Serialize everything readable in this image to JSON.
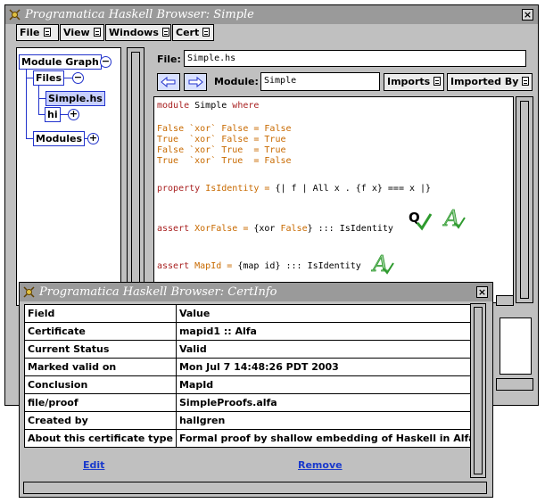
{
  "main_window": {
    "title": "Programatica Haskell Browser: Simple",
    "close_label": "×",
    "menu": [
      {
        "label": "File"
      },
      {
        "label": "View"
      },
      {
        "label": "Windows"
      },
      {
        "label": "Cert"
      }
    ],
    "tree": {
      "module_graph": "Module Graph",
      "files": "Files",
      "simple_hs": "Simple.hs",
      "hi": "hi",
      "modules": "Modules"
    },
    "file_label": "File:",
    "file_value": "Simple.hs",
    "module_label": "Module:",
    "module_value": "Simple",
    "imports_label": "Imports",
    "imported_by_label": "Imported By",
    "code": {
      "line1_kw": "module",
      "line1_rest": " Simple ",
      "line1_kw2": "where",
      "xor1": "False `xor` False = False",
      "xor2": "True  `xor` False = True",
      "xor3": "False `xor` True  = True",
      "xor4": "True  `xor` True  = False",
      "prop_kw": "property",
      "prop_name": " IsIdentity = ",
      "prop_body": "{| f | All x . {f x} === x |}",
      "assert1_kw": "assert",
      "assert1_name": " XorFalse = ",
      "assert1_body_a": "{xor ",
      "assert1_body_b": "False",
      "assert1_body_c": "} ::: IsIdentity",
      "assert2_kw": "assert",
      "assert2_name": " MapId = ",
      "assert2_body": "{map id} ::: IsIdentity"
    },
    "cert_icons": [
      "q-check-icon",
      "alfa-icon",
      "alfa-icon"
    ],
    "icon_letters": {
      "q": "Q",
      "alfa": "A"
    }
  },
  "cert_window": {
    "title": "Programatica Haskell Browser: CertInfo",
    "close_label": "×",
    "table": {
      "header": [
        "Field",
        "Value"
      ],
      "rows": [
        [
          "Certificate",
          "mapid1 :: Alfa"
        ],
        [
          "Current Status",
          "Valid"
        ],
        [
          "Marked valid on",
          "Mon Jul  7 14:48:26 PDT 2003"
        ],
        [
          "Conclusion",
          "MapId"
        ],
        [
          "file/proof",
          "SimpleProofs.alfa"
        ],
        [
          "Created by",
          "hallgren"
        ],
        [
          "About this certificate type",
          "Formal proof by shallow embedding of Haskell in Alfa"
        ]
      ]
    },
    "edit_label": "Edit",
    "remove_label": "Remove"
  },
  "colors": {
    "keyword": "#a82020",
    "orange": "#c86a00",
    "tree_blue": "#2233cc",
    "link_blue": "#1a3acc",
    "icon_green": "#2e9a2e"
  }
}
